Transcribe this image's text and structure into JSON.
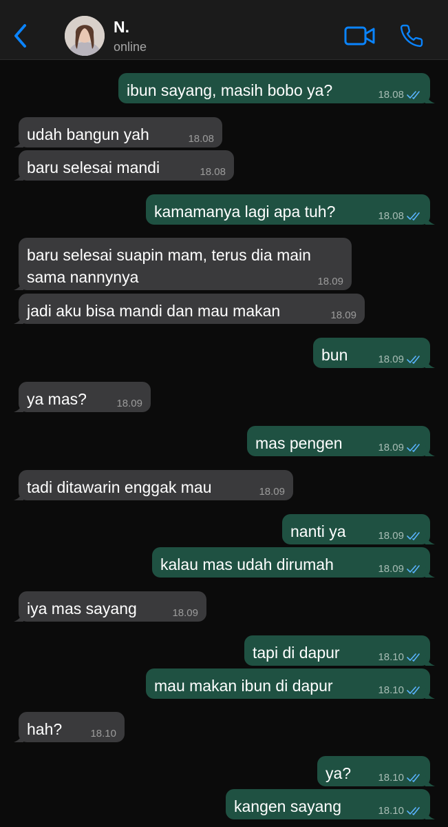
{
  "header": {
    "back_icon": "chevron-left-icon",
    "contact_name": "N.",
    "contact_status": "online",
    "video_icon": "video-camera-icon",
    "call_icon": "phone-icon",
    "accent_color": "#0a84ff"
  },
  "messages": [
    {
      "direction": "out",
      "text": "ibun sayang, masih bobo ya?",
      "time": "18.08",
      "read": true
    },
    {
      "direction": "in",
      "text": "udah bangun yah",
      "time": "18.08"
    },
    {
      "direction": "in",
      "text": "baru selesai mandi",
      "time": "18.08"
    },
    {
      "direction": "out",
      "text": "kamamanya lagi apa tuh?",
      "time": "18.08",
      "read": true
    },
    {
      "direction": "in",
      "text": "baru selesai suapin mam, terus dia main\nsama nannynya",
      "time": "18.09"
    },
    {
      "direction": "in",
      "text": "jadi aku bisa mandi dan mau makan",
      "time": "18.09"
    },
    {
      "direction": "out",
      "text": "bun",
      "time": "18.09",
      "read": true
    },
    {
      "direction": "in",
      "text": "ya mas?",
      "time": "18.09"
    },
    {
      "direction": "out",
      "text": "mas pengen",
      "time": "18.09",
      "read": true
    },
    {
      "direction": "in",
      "text": "tadi ditawarin enggak mau",
      "time": "18.09"
    },
    {
      "direction": "out",
      "text": "nanti ya",
      "time": "18.09",
      "read": true
    },
    {
      "direction": "out",
      "text": "kalau mas udah dirumah",
      "time": "18.09",
      "read": true
    },
    {
      "direction": "in",
      "text": "iya mas sayang",
      "time": "18.09"
    },
    {
      "direction": "out",
      "text": "tapi di dapur",
      "time": "18.10",
      "read": true
    },
    {
      "direction": "out",
      "text": "mau makan ibun di dapur",
      "time": "18.10",
      "read": true
    },
    {
      "direction": "in",
      "text": "hah?",
      "time": "18.10"
    },
    {
      "direction": "out",
      "text": "ya?",
      "time": "18.10",
      "read": true
    },
    {
      "direction": "out",
      "text": "kangen sayang",
      "time": "18.10",
      "read": true
    }
  ],
  "colors": {
    "outgoing_bubble": "#1f5142",
    "incoming_bubble": "#3a3a3c",
    "read_ticks": "#5ab4ff"
  }
}
